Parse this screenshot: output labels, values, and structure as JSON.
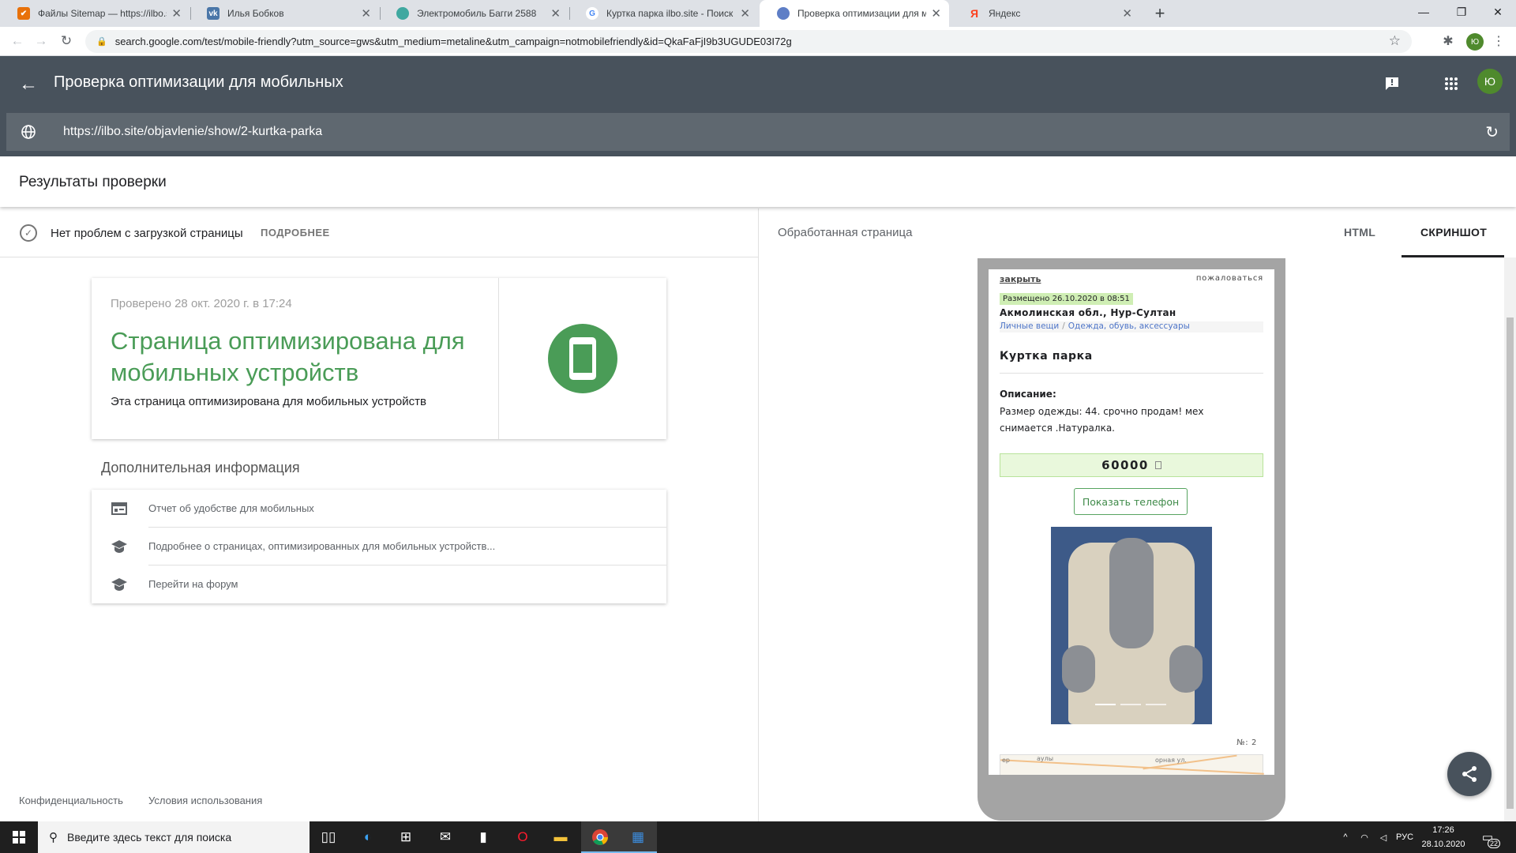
{
  "browser": {
    "tabs": [
      {
        "title": "Файлы Sitemap — https://ilbo.si",
        "favicon": "search-console-icon",
        "fav_color": "#e8710a",
        "active": false
      },
      {
        "title": "Илья Бобков",
        "favicon": "vk-icon",
        "fav_color": "#4a76a8",
        "active": false
      },
      {
        "title": "Электромобиль Багги 2588",
        "favicon": "ilbo-icon",
        "fav_color": "#3fa8a0",
        "active": false
      },
      {
        "title": "Куртка парка ilbo.site - Поиск в",
        "favicon": "google-icon",
        "fav_color": "#4285f4",
        "active": false
      },
      {
        "title": "Проверка оптимизации для мо",
        "favicon": "google-search-console-icon",
        "fav_color": "#5e7ec6",
        "active": true
      },
      {
        "title": "Яндекс",
        "favicon": "yandex-icon",
        "fav_color": "#fc3f1d",
        "active": false
      }
    ],
    "address": "search.google.com/test/mobile-friendly?utm_source=gws&utm_medium=metaline&utm_campaign=notmobilefriendly&id=QkaFaFjI9b3UGUDE03I72g",
    "profile_initial": "Ю"
  },
  "app": {
    "title": "Проверка оптимизации для мобильных",
    "tested_url": "https://ilbo.site/objavlenie/show/2-kurtka-parka",
    "avatar_initial": "Ю"
  },
  "results": {
    "title": "Результаты проверки",
    "status_text": "Нет проблем с загрузкой страницы",
    "more_label": "ПОДРОБНЕЕ",
    "checked_at": "Проверено 28 окт. 2020 г. в 17:24",
    "headline": "Страница оптимизирована для мобильных устройств",
    "subtext": "Эта страница оптимизирована для мобильных устройств",
    "additional_title": "Дополнительная информация",
    "links": [
      {
        "label": "Отчет об удобстве для мобильных",
        "icon": "report-icon"
      },
      {
        "label": "Подробнее о страницах, оптимизированных для мобильных устройств...",
        "icon": "school-icon"
      },
      {
        "label": "Перейти на форум",
        "icon": "school-icon"
      }
    ],
    "footer": {
      "privacy": "Конфиденциальность",
      "terms": "Условия использования"
    }
  },
  "right_pane": {
    "title": "Обработанная страница",
    "tabs": [
      "HTML",
      "СКРИНШОТ"
    ],
    "active_tab": "СКРИНШОТ"
  },
  "screenshot": {
    "close": "закрыть",
    "report": "пожаловаться",
    "posted": "Размещено 26.10.2020 в 08:51",
    "region": "Акмолинская обл., Нур-Султан",
    "breadcrumb": [
      "Личные вещи",
      "Одежда, обувь, аксессуары"
    ],
    "item_title": "Куртка парка",
    "desc_label": "Описание:",
    "desc": "Размер одежды: 44. срочно продам! мех снимается .Натуралка.",
    "price": "60000",
    "show_phone": "Показать телефон",
    "number": "№: 2",
    "map_labels": [
      "ер",
      "аулы",
      "орная ул."
    ]
  },
  "taskbar": {
    "search_placeholder": "Введите здесь текст для поиска",
    "lang": "РУС",
    "time": "17:26",
    "date": "28.10.2020",
    "notifications": "22"
  }
}
